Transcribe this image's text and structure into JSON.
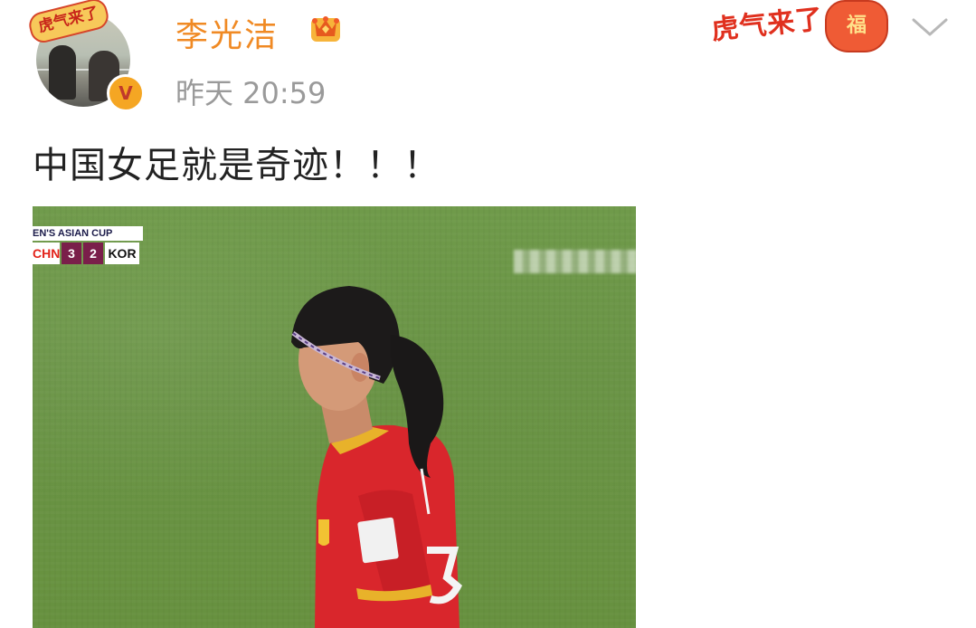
{
  "header": {
    "username": "李光洁",
    "timestamp": "昨天 20:59",
    "avatar_badge": "虎气来了",
    "verify_badge": "V",
    "sticker_text": "虎气来了",
    "sticker_bag": "福"
  },
  "post": {
    "text": "中国女足就是奇迹！！！"
  },
  "scoreboard": {
    "title": "EN'S ASIAN CUP",
    "team_home": "CHN",
    "score_home": "3",
    "score_away": "2",
    "team_away": "KOR"
  },
  "colors": {
    "username": "#f08a24",
    "timestamp": "#9a9a9a",
    "grass": "#6a9446",
    "jersey": "#d9262c"
  },
  "icons": [
    "crown-icon",
    "chevron-down-icon",
    "verified-icon"
  ]
}
